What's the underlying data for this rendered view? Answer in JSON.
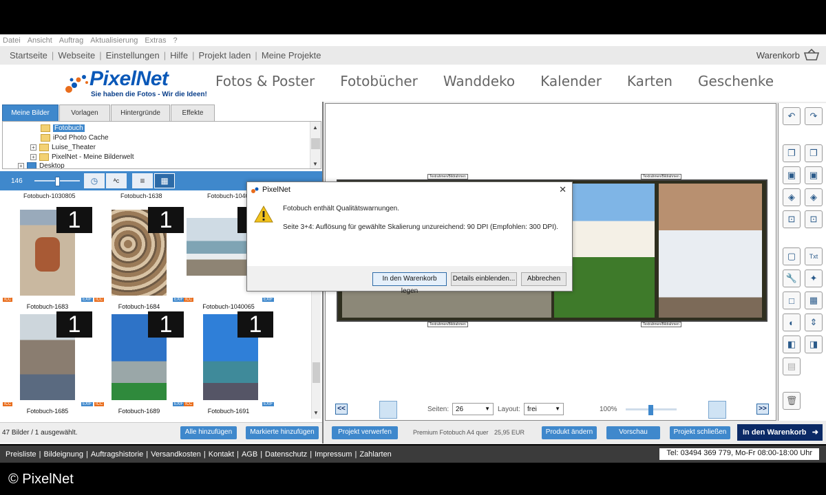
{
  "menubar": [
    "Datei",
    "Ansicht",
    "Auftrag",
    "Aktualisierung",
    "Extras",
    "?"
  ],
  "navbar": [
    "Startseite",
    "Webseite",
    "Einstellungen",
    "Hilfe",
    "Projekt laden",
    "Meine Projekte"
  ],
  "cart_label": "Warenkorb",
  "logo": {
    "name": "PixelNet",
    "tagline": "Sie haben die Fotos - Wir die Ideen!"
  },
  "mainnav": [
    "Fotos & Poster",
    "Fotobücher",
    "Wanddeko",
    "Kalender",
    "Karten",
    "Geschenke"
  ],
  "tabs": [
    "Meine Bilder",
    "Vorlagen",
    "Hintergründe",
    "Effekte"
  ],
  "tree": [
    "Fotobuch",
    "iPod Photo Cache",
    "Luise_Theater",
    "PixelNet - Meine Bilderwelt",
    "Desktop"
  ],
  "toolbar": {
    "zoom_value": "146",
    "sort_label": "ᴬᴄ"
  },
  "top_captions": [
    "Fotobuch-1030805",
    "Fotobuch-1638",
    "Fotobuch-1040"
  ],
  "thumbs": [
    {
      "caption": "Fotobuch-1683",
      "count": "1"
    },
    {
      "caption": "Fotobuch-1684",
      "count": "1"
    },
    {
      "caption": "Fotobuch-1040065",
      "count": "1"
    },
    {
      "caption": "Fotobuch-1685",
      "count": "1"
    },
    {
      "caption": "Fotobuch-1689",
      "count": "1"
    },
    {
      "caption": "Fotobuch-1691",
      "count": "1"
    }
  ],
  "badges": {
    "exif": "EXIF",
    "icc": "ICC"
  },
  "left_footer": {
    "status": "47 Bilder / 1 ausgewählt.",
    "add_all": "Alle hinzufügen",
    "add_marked": "Markierte hinzufügen"
  },
  "spread_labels": [
    "Textrahmen/Bildrahmen"
  ],
  "pagebar": {
    "pages_label": "Seiten:",
    "pages_value": "26",
    "layout_label": "Layout:",
    "layout_value": "frei",
    "zoom": "100%",
    "prev": "<<",
    "next": ">>"
  },
  "actionbar": {
    "discard": "Projekt verwerfen",
    "product": "Premium Fotobuch A4 quer",
    "price": "25,95 EUR",
    "change": "Produkt ändern",
    "preview": "Vorschau",
    "close": "Projekt schließen",
    "cart": "In den Warenkorb"
  },
  "footer": [
    "Preisliste",
    "Bildeignung",
    "Auftragshistorie",
    "Versandkosten",
    "Kontakt",
    "AGB",
    "Datenschutz",
    "Impressum",
    "Zahlarten"
  ],
  "phone": "Tel: 03494 369 779, Mo-Fr 08:00-18:00 Uhr",
  "copyright": "© PixelNet",
  "dialog": {
    "title": "PixelNet",
    "close": "✕",
    "message1": "Fotobuch enthält Qualitätswarnungen.",
    "message2": "Seite 3+4: Auflösung für gewählte Skalierung unzureichend: 90 DPI (Empfohlen: 300 DPI).",
    "btn_cart": "In den Warenkorb legen",
    "btn_details": "Details einblenden...",
    "btn_cancel": "Abbrechen"
  },
  "colors": {
    "accent": "#3f88cc",
    "cart_button": "#0b2a66",
    "footer": "#3b3b3b"
  }
}
